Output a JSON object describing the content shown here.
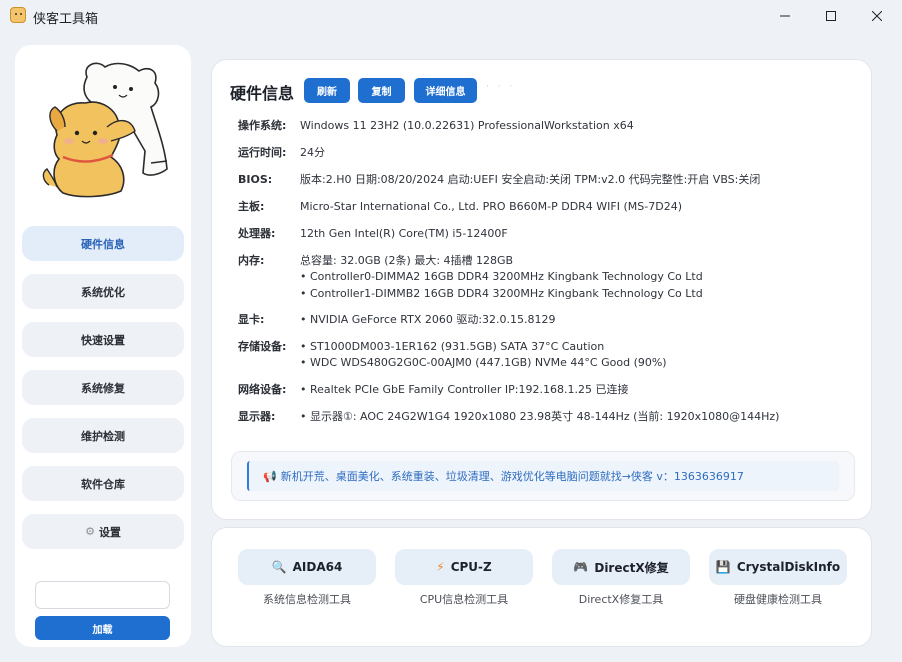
{
  "window": {
    "title": "侠客工具箱",
    "minimize": "—",
    "maximize": "☐",
    "close": "✕"
  },
  "sidebar": {
    "items": [
      {
        "label": "硬件信息",
        "active": true
      },
      {
        "label": "系统优化"
      },
      {
        "label": "快速设置"
      },
      {
        "label": "系统修复"
      },
      {
        "label": "维护检测"
      },
      {
        "label": "软件仓库"
      },
      {
        "label": "设置",
        "icon": "gear-icon"
      }
    ],
    "load_input_value": "",
    "load_button": "加载"
  },
  "hardware": {
    "title": "硬件信息",
    "buttons": {
      "refresh": "刷新",
      "copy": "复制",
      "detail": "详细信息"
    },
    "rows": [
      {
        "label": "操作系统:",
        "lines": [
          "Windows 11 23H2 (10.0.22631) ProfessionalWorkstation x64"
        ]
      },
      {
        "label": "运行时间:",
        "lines": [
          "24分"
        ]
      },
      {
        "label": "BIOS:",
        "lines": [
          "版本:2.H0 日期:08/20/2024 启动:UEFI 安全启动:关闭 TPM:v2.0 代码完整性:开启 VBS:关闭"
        ]
      },
      {
        "label": "主板:",
        "lines": [
          "Micro-Star International Co., Ltd. PRO B660M-P DDR4 WIFI (MS-7D24)"
        ]
      },
      {
        "label": "处理器:",
        "lines": [
          "12th Gen Intel(R) Core(TM) i5-12400F"
        ]
      },
      {
        "label": "内存:",
        "lines": [
          "总容量: 32.0GB (2条) 最大: 4插槽 128GB",
          "• Controller0-DIMMA2 16GB DDR4 3200MHz Kingbank Technology Co Ltd",
          "• Controller1-DIMMB2 16GB DDR4 3200MHz Kingbank Technology Co Ltd"
        ]
      },
      {
        "label": "显卡:",
        "lines": [
          "• NVIDIA GeForce RTX 2060 驱动:32.0.15.8129"
        ]
      },
      {
        "label": "存储设备:",
        "lines": [
          "• ST1000DM003-1ER162 (931.5GB) SATA 37°C Caution",
          "• WDC WDS480G2G0C-00AJM0 (447.1GB) NVMe 44°C Good (90%)"
        ]
      },
      {
        "label": "网络设备:",
        "lines": [
          "• Realtek PCIe GbE Family Controller IP:192.168.1.25 已连接"
        ]
      },
      {
        "label": "显示器:",
        "lines": [
          "• 显示器①: AOC 24G2W1G4 1920x1080 23.98英寸 48-144Hz (当前: 1920x1080@144Hz)"
        ]
      }
    ],
    "notice": "新机开荒、桌面美化、系统重装、垃圾清理、游戏优化等电脑问题就找→侠客 v：1363636917"
  },
  "tools": [
    {
      "label": "AIDA64",
      "icon": "magnifier-icon",
      "glyph": "🔍",
      "caption": "系统信息检测工具"
    },
    {
      "label": "CPU-Z",
      "icon": "lightning-icon",
      "glyph": "⚡",
      "caption": "CPU信息检测工具"
    },
    {
      "label": "DirectX修复",
      "icon": "gamepad-icon",
      "glyph": "🎮",
      "caption": "DirectX修复工具"
    },
    {
      "label": "CrystalDiskInfo",
      "icon": "disk-icon",
      "glyph": "💾",
      "caption": "硬盘健康检测工具"
    }
  ],
  "colors": {
    "accent": "#1f6fd1",
    "active_nav_bg": "#e3edf9",
    "notice_text": "#2f6cc0"
  }
}
